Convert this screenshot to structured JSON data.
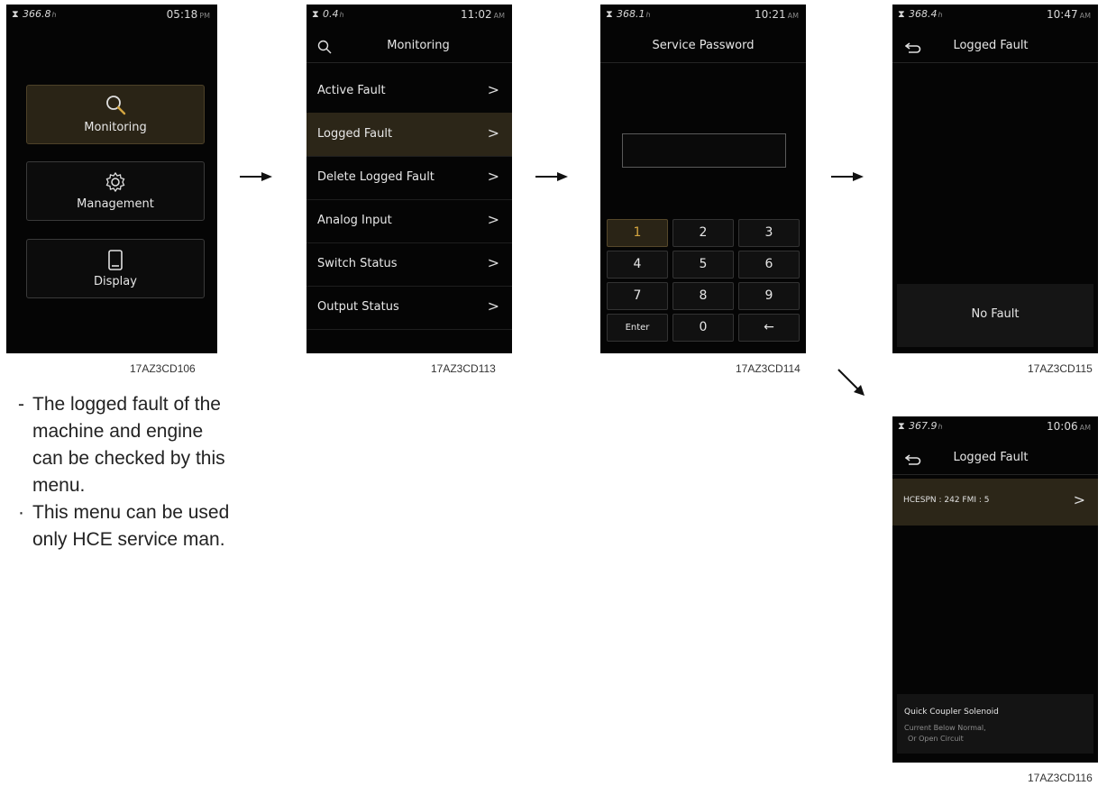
{
  "screen1": {
    "status": {
      "hours": "366.8",
      "unit": "h",
      "time": "05:18",
      "ampm": "PM"
    },
    "buttons": [
      {
        "label": "Monitoring",
        "icon": "search-icon"
      },
      {
        "label": "Management",
        "icon": "gear-icon"
      },
      {
        "label": "Display",
        "icon": "display-icon"
      }
    ],
    "caption": "17AZ3CD106"
  },
  "screen2": {
    "status": {
      "hours": "0.4",
      "unit": "h",
      "time": "11:02",
      "ampm": "AM"
    },
    "title": "Monitoring",
    "items": [
      "Active Fault",
      "Logged Fault",
      "Delete Logged Fault",
      "Analog Input",
      "Switch Status",
      "Output Status"
    ],
    "chevron": ">",
    "caption": "17AZ3CD113"
  },
  "screen3": {
    "status": {
      "hours": "368.1",
      "unit": "h",
      "time": "10:21",
      "ampm": "AM"
    },
    "title": "Service Password",
    "keys": [
      "1",
      "2",
      "3",
      "4",
      "5",
      "6",
      "7",
      "8",
      "9",
      "Enter",
      "0",
      "←"
    ],
    "caption": "17AZ3CD114"
  },
  "screen4": {
    "status": {
      "hours": "368.4",
      "unit": "h",
      "time": "10:47",
      "ampm": "AM"
    },
    "title": "Logged Fault",
    "message": "No Fault",
    "caption": "17AZ3CD115"
  },
  "screen5": {
    "status": {
      "hours": "367.9",
      "unit": "h",
      "time": "10:06",
      "ampm": "AM"
    },
    "title": "Logged Fault",
    "fault": "HCESPN : 242  FMI : 5",
    "chevron": ">",
    "detail_title": "Quick Coupler Solenoid",
    "detail_line1": "Current Below Normal,",
    "detail_line2": "Or Open Circuit",
    "caption": "17AZ3CD116"
  },
  "text": {
    "dash": "-",
    "dot": "·",
    "line1": "The logged fault of the machine and engine can be checked by this menu.",
    "line2": "This menu can be used only HCE service man."
  }
}
